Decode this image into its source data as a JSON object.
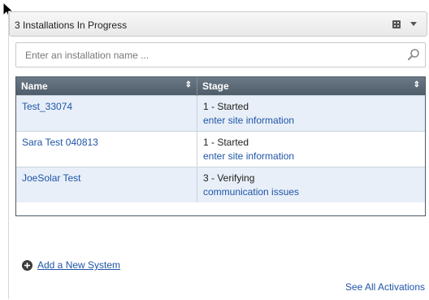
{
  "panel": {
    "title": "3 Installations In Progress",
    "header_icons": [
      "grid-menu-icon",
      "chevron-down-icon"
    ]
  },
  "search": {
    "placeholder": "Enter an installation name ...",
    "value": ""
  },
  "table": {
    "columns": [
      "Name",
      "Stage"
    ],
    "rows": [
      {
        "name": "Test_33074",
        "stage": "1 - Started",
        "stage_link": "enter site information"
      },
      {
        "name": "Sara Test 040813",
        "stage": "1 - Started",
        "stage_link": "enter site information"
      },
      {
        "name": "JoeSolar Test",
        "stage": "3 - Verifying",
        "stage_link": "communication issues"
      }
    ]
  },
  "footer": {
    "add_label": "Add a New System",
    "see_all_label": "See All Activations"
  },
  "colors": {
    "link": "#1f55a8",
    "table_header": "#5c6a77",
    "row_alt": "#e8eff8"
  }
}
